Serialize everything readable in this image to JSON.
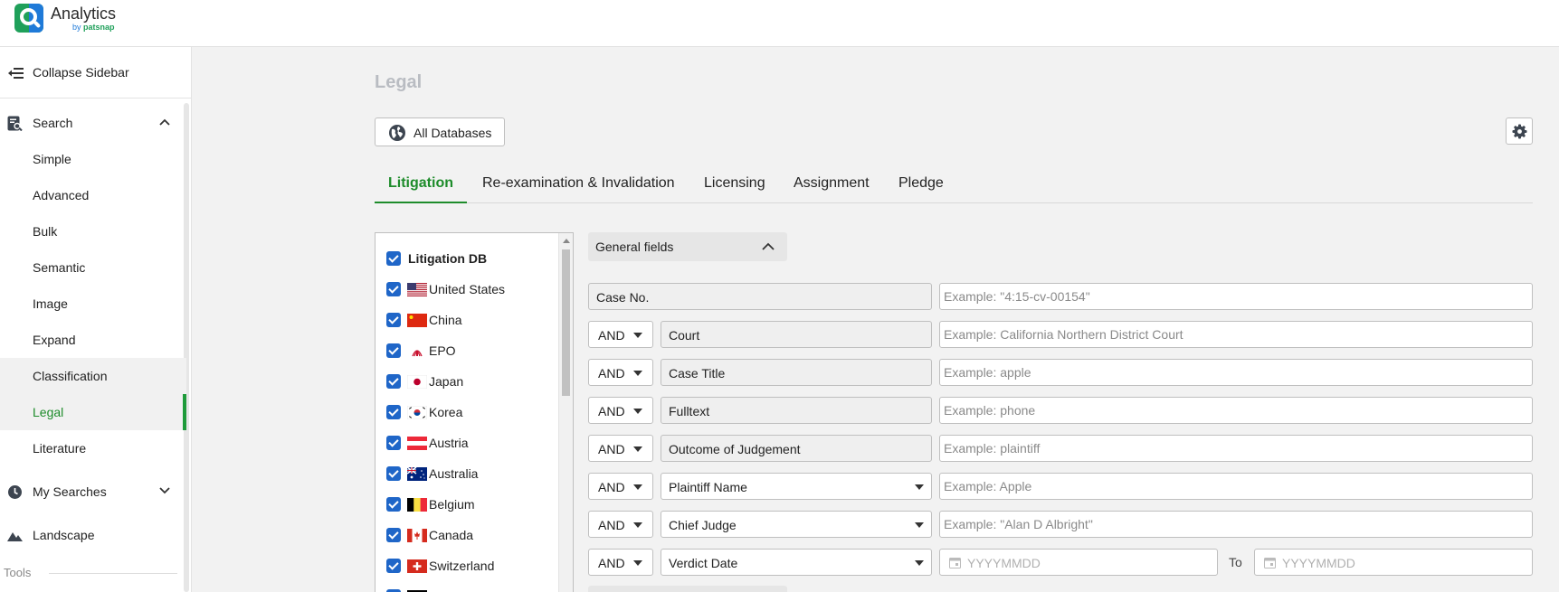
{
  "app": {
    "title": "Analytics",
    "subtitle_by": "by",
    "subtitle_brand": "patsnap"
  },
  "sidebar": {
    "collapse_label": "Collapse Sidebar",
    "search": {
      "label": "Search"
    },
    "items": [
      {
        "label": "Simple"
      },
      {
        "label": "Advanced"
      },
      {
        "label": "Bulk"
      },
      {
        "label": "Semantic"
      },
      {
        "label": "Image"
      },
      {
        "label": "Expand"
      },
      {
        "label": "Classification"
      },
      {
        "label": "Legal"
      },
      {
        "label": "Literature"
      }
    ],
    "active_item": "Legal",
    "my_searches": {
      "label": "My Searches"
    },
    "landscape": {
      "label": "Landscape"
    },
    "tools_label": "Tools"
  },
  "main": {
    "page_title": "Legal",
    "db_button_label": "All Databases",
    "tabs": [
      {
        "label": "Litigation",
        "active": true
      },
      {
        "label": "Re-examination & Invalidation",
        "active": false
      },
      {
        "label": "Licensing",
        "active": false
      },
      {
        "label": "Assignment",
        "active": false
      },
      {
        "label": "Pledge",
        "active": false
      }
    ],
    "db_list": {
      "header": "Litigation DB",
      "items": [
        {
          "label": "United States",
          "flag": "us"
        },
        {
          "label": "China",
          "flag": "cn"
        },
        {
          "label": "EPO",
          "flag": "epo"
        },
        {
          "label": "Japan",
          "flag": "jp"
        },
        {
          "label": "Korea",
          "flag": "kr"
        },
        {
          "label": "Austria",
          "flag": "at"
        },
        {
          "label": "Australia",
          "flag": "au"
        },
        {
          "label": "Belgium",
          "flag": "be"
        },
        {
          "label": "Canada",
          "flag": "ca"
        },
        {
          "label": "Switzerland",
          "flag": "ch"
        }
      ]
    },
    "general_fields_label": "General fields",
    "fields": [
      {
        "operator": "",
        "name": "Case No.",
        "placeholder": "Example: \"4:15-cv-00154\""
      },
      {
        "operator": "AND",
        "name": "Court",
        "placeholder": "Example: California Northern District Court"
      },
      {
        "operator": "AND",
        "name": "Case Title",
        "placeholder": "Example: apple"
      },
      {
        "operator": "AND",
        "name": "Fulltext",
        "placeholder": "Example: phone"
      },
      {
        "operator": "AND",
        "name": "Outcome of Judgement",
        "placeholder": "Example: plaintiff"
      },
      {
        "operator": "AND",
        "name": "Plaintiff Name",
        "placeholder": "Example: Apple"
      },
      {
        "operator": "AND",
        "name": "Chief Judge",
        "placeholder": "Example: \"Alan D Albright\""
      },
      {
        "operator": "AND",
        "name": "Verdict Date",
        "date_from_placeholder": "YYYYMMDD",
        "to_label": "To",
        "date_to_placeholder": "YYYYMMDD"
      }
    ]
  },
  "colors": {
    "accent_green": "#1e8c2b",
    "checkbox_blue": "#1f66c8",
    "title_gray": "#b9bcc2"
  }
}
